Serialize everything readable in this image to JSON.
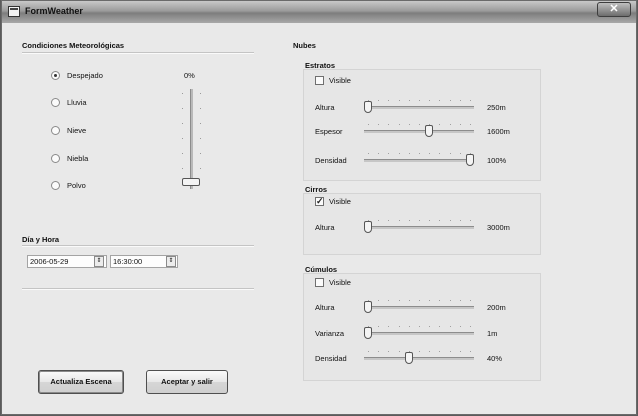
{
  "window": {
    "title": "FormWeather",
    "close_label": "✕"
  },
  "conditions": {
    "title": "Condiciones Meteorológicas",
    "options": [
      "Despejado",
      "Lluvia",
      "Nieve",
      "Niebla",
      "Polvo"
    ],
    "selected": "Despejado",
    "intensity_value": "0%",
    "intensity_level": 0
  },
  "datetime": {
    "title": "Día y Hora",
    "date": "2006-05-29",
    "time": "16:30:00"
  },
  "buttons": {
    "update": "Actualiza Escena",
    "accept": "Aceptar y salir"
  },
  "clouds": {
    "title": "Nubes",
    "visible_label": "Visible",
    "estratos": {
      "title": "Estratos",
      "visible": false,
      "altura_label": "Altura",
      "altura_value": "250m",
      "altura_level": 0,
      "espesor_label": "Espesor",
      "espesor_value": "1600m",
      "espesor_level": 0.6,
      "densidad_label": "Densidad",
      "densidad_value": "100%",
      "densidad_level": 1.0
    },
    "cirros": {
      "title": "Cirros",
      "visible": true,
      "altura_label": "Altura",
      "altura_value": "3000m",
      "altura_level": 0
    },
    "cumulos": {
      "title": "Cúmulos",
      "visible": false,
      "altura_label": "Altura",
      "altura_value": "200m",
      "altura_level": 0,
      "varianza_label": "Varianza",
      "varianza_value": "1m",
      "varianza_level": 0,
      "densidad_label": "Densidad",
      "densidad_value": "40%",
      "densidad_level": 0.4
    }
  }
}
